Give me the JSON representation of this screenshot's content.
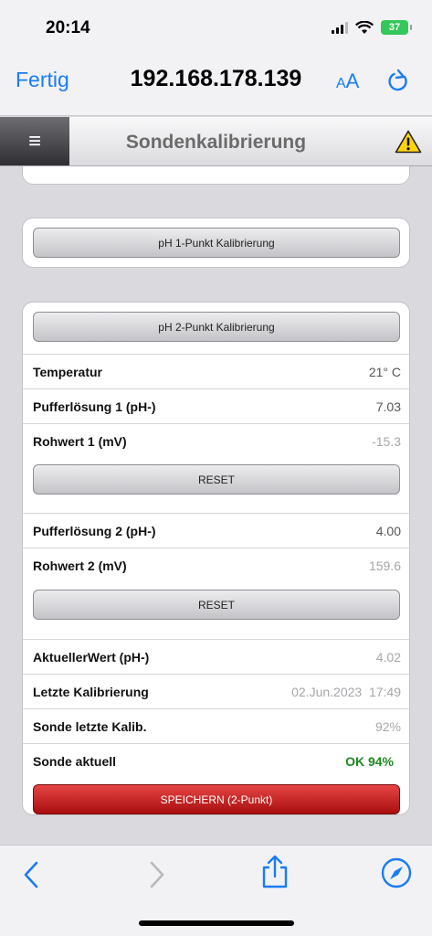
{
  "status": {
    "time": "20:14",
    "battery": "37"
  },
  "browser": {
    "done": "Fertig",
    "url": "192.168.178.139",
    "text_size_a_small": "A",
    "text_size_a_large": "A"
  },
  "header": {
    "menu_glyph": "≡",
    "title": "Sondenkalibrierung",
    "warning_icon": "warning-triangle-icon"
  },
  "buttons": {
    "ph1": "pH 1-Punkt Kalibrierung",
    "ph2": "pH 2-Punkt Kalibrierung",
    "reset1": "RESET",
    "reset2": "RESET",
    "save": "SPEICHERN (2-Punkt)"
  },
  "rows": {
    "temperature": {
      "label": "Temperatur",
      "value": "21° C"
    },
    "buffer1": {
      "label": "Pufferlösung 1 (pH-)",
      "value": "7.03"
    },
    "raw1": {
      "label": "Rohwert 1 (mV)",
      "value": "-15.3"
    },
    "buffer2": {
      "label": "Pufferlösung 2 (pH-)",
      "value": "4.00"
    },
    "raw2": {
      "label": "Rohwert 2 (mV)",
      "value": "159.6"
    },
    "current": {
      "label": "AktuellerWert (pH-)",
      "value": "4.02"
    },
    "last_cal": {
      "label": "Letzte Kalibrierung",
      "value": "02.Jun.2023  17:49"
    },
    "probe_last": {
      "label": "Sonde letzte Kalib.",
      "value": "92%"
    },
    "probe_now": {
      "label": "Sonde aktuell",
      "value": "OK 94%"
    }
  },
  "colors": {
    "accent": "#1a7cf5",
    "ok": "#1d8a1d",
    "save": "#c01818"
  }
}
